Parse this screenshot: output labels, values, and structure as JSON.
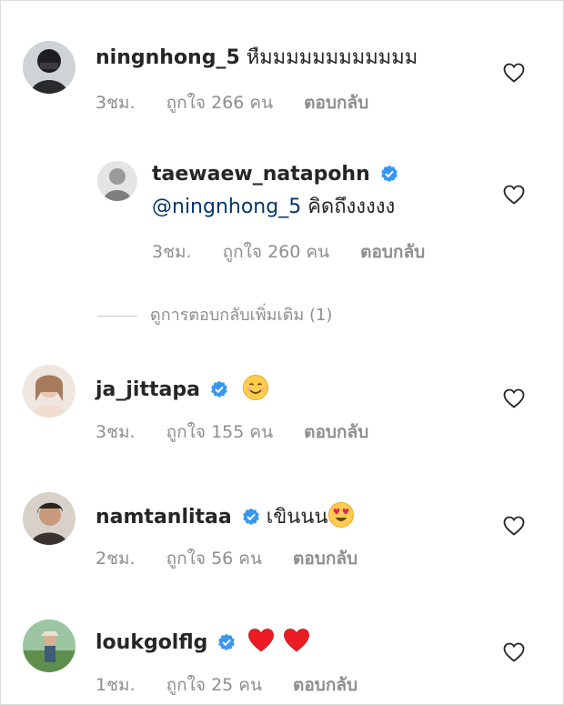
{
  "comments": [
    {
      "username": "ningnhong_5",
      "text": "หืมมมมมมมมมมมม",
      "time": "3ชม.",
      "likes": "ถูกใจ 266 คน",
      "reply": "ตอบกลับ",
      "verified": false
    },
    {
      "username": "taewaew_natapohn",
      "mention": "@ningnhong_5",
      "text": "คิดถึงงงงง",
      "time": "3ชม.",
      "likes": "ถูกใจ 260 คน",
      "reply": "ตอบกลับ",
      "verified": true
    },
    {
      "username": "ja_jittapa",
      "text": "",
      "emoji": "smiling-face-emoji",
      "time": "3ชม.",
      "likes": "ถูกใจ 155 คน",
      "reply": "ตอบกลับ",
      "verified": true
    },
    {
      "username": "namtanlitaa",
      "text": "เขินนน",
      "emoji": "heart-eyes-emoji",
      "time": "2ชม.",
      "likes": "ถูกใจ 56 คน",
      "reply": "ตอบกลับ",
      "verified": true
    },
    {
      "username": "loukgolflg",
      "text": "",
      "emoji": "red-heart-emoji",
      "time": "1ชม.",
      "likes": "ถูกใจ 25 คน",
      "reply": "ตอบกลับ",
      "verified": true
    }
  ],
  "view_more_replies": "ดูการตอบกลับเพิ่มเติม (1)",
  "colors": {
    "verified_blue": "#3897f0",
    "secondary_text": "#8e8e8e",
    "mention": "#00376b",
    "heart_red": "#ed1c24"
  }
}
